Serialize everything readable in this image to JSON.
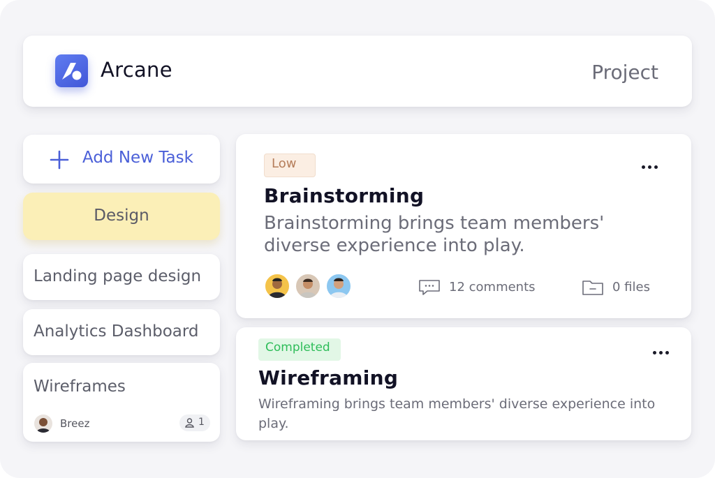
{
  "header": {
    "brand": "Arcane",
    "nav_link": "Project",
    "logo_icon": "arcane-logo-icon",
    "accent_color": "#4a5fd8"
  },
  "sidebar": {
    "add_task": {
      "label": "Add New Task",
      "icon": "plus-icon"
    },
    "items": [
      {
        "label": "Design",
        "active": true,
        "color": "#fbefb7"
      },
      {
        "label": "Landing page design"
      },
      {
        "label": "Analytics Dashboard"
      },
      {
        "label": "Wireframes",
        "assignee": "Breez",
        "member_count": "1",
        "member_icon": "user-icon"
      }
    ]
  },
  "tasks": [
    {
      "priority": "Low",
      "title": "Brainstorming",
      "description": "Brainstorming brings team members' diverse experience into play.",
      "comments": "12 comments",
      "files": "0 files",
      "comments_icon": "comment-icon",
      "files_icon": "folder-icon",
      "badge_color": "#b57d5a"
    },
    {
      "status": "Completed",
      "title": "Wireframing",
      "description": "Wireframing brings team members' diverse experience into play.",
      "badge_color": "#2ebd59"
    }
  ]
}
